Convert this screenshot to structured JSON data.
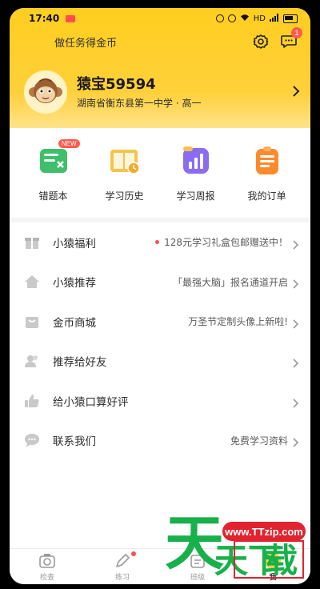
{
  "status": {
    "time": "17:40",
    "network": "HD"
  },
  "header": {
    "task_text": "做任务得金币",
    "message_badge": "1"
  },
  "profile": {
    "name": "猿宝59594",
    "school": "湖南省衡东县第一中学 · 高一"
  },
  "quick_actions": [
    {
      "label": "错题本",
      "badge": "NEW",
      "icon": "wrong-notebook-icon"
    },
    {
      "label": "学习历史",
      "icon": "study-history-icon"
    },
    {
      "label": "学习周报",
      "icon": "weekly-report-icon"
    },
    {
      "label": "我的订单",
      "icon": "orders-icon"
    }
  ],
  "menu": [
    {
      "label": "小猿福利",
      "value": "128元学习礼盒包邮赠送中！",
      "icon": "gift-icon",
      "has_dot": true
    },
    {
      "label": "小猿推荐",
      "value": "「最强大脑」报名通道开启",
      "icon": "home-icon"
    },
    {
      "label": "金币商城",
      "value": "万圣节定制头像上新啦!",
      "icon": "mall-icon"
    },
    {
      "label": "推荐给好友",
      "value": "",
      "icon": "friends-icon"
    },
    {
      "label": "给小猿口算好评",
      "value": "",
      "icon": "thumbs-up-icon"
    },
    {
      "label": "联系我们",
      "value": "免费学习资料",
      "icon": "chat-icon"
    }
  ],
  "tabs": [
    {
      "label": "检查",
      "icon": "camera-icon"
    },
    {
      "label": "练习",
      "icon": "pencil-icon"
    },
    {
      "label": "班级",
      "icon": "class-icon"
    },
    {
      "label": "我",
      "icon": "me-icon"
    }
  ],
  "watermark": {
    "url": "www.TTzip.com",
    "big": "天",
    "small1": "天下",
    "small2": "载"
  },
  "colors": {
    "accent_yellow": "#ffce1f",
    "badge_red": "#ff5a4f"
  }
}
